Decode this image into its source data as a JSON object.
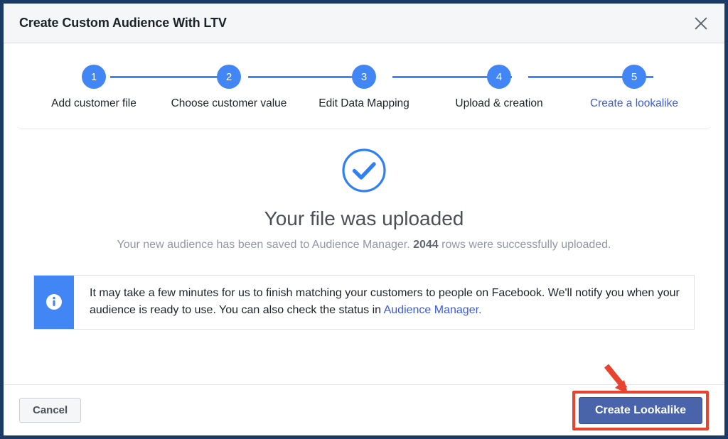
{
  "dialog": {
    "title": "Create Custom Audience With LTV",
    "close_icon": "close-icon"
  },
  "stepper": {
    "steps": [
      {
        "number": "1",
        "label": "Add customer file",
        "active": false
      },
      {
        "number": "2",
        "label": "Choose customer value",
        "active": false
      },
      {
        "number": "3",
        "label": "Edit Data Mapping",
        "active": false
      },
      {
        "number": "4",
        "label": "Upload & creation",
        "active": false
      },
      {
        "number": "5",
        "label": "Create a lookalike",
        "active": true
      }
    ],
    "accent_color": "#4285f4",
    "active_label_color": "#3b5ae0"
  },
  "success": {
    "icon": "check-circle-icon",
    "title": "Your file was uploaded",
    "subtitle_before": "Your new audience has been saved to Audience Manager. ",
    "subtitle_count": "2044",
    "subtitle_after": " rows were successfully uploaded."
  },
  "info_banner": {
    "icon": "info-icon",
    "text_before": "It may take a few minutes for us to finish matching your customers to people on Facebook. We'll notify you when your audience is ready to use. You can also check the status in ",
    "link_text": "Audience Manager.",
    "icon_bg_color": "#4285f4",
    "link_color": "#3b5ae0"
  },
  "footer": {
    "cancel_label": "Cancel",
    "primary_label": "Create Lookalike",
    "primary_color": "#4a64ab",
    "annotation_color": "#e8432f",
    "annotation_arrow_icon": "arrow-down-right-icon"
  }
}
